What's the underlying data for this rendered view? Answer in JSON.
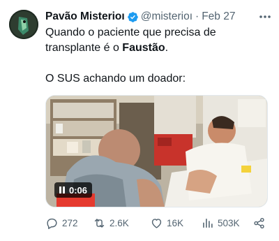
{
  "tweet": {
    "author_name": "Pavão Misterioı",
    "handle": "@misterioı",
    "separator": "·",
    "date": "Feb 27",
    "text_line1": "Quando o paciente que precisa de transplante é o ",
    "text_bold": "Faustão",
    "text_line1_end": ".",
    "text_line2": "O SUS achando um doador:",
    "media": {
      "time": "0:06"
    }
  },
  "actions": {
    "replies": "272",
    "reposts": "2.6K",
    "likes": "16K",
    "views": "503K"
  },
  "icons": {
    "verified": "verified-badge-icon",
    "more": "more-dots-icon",
    "reply": "reply-icon",
    "repost": "repost-icon",
    "like": "heart-icon",
    "views": "views-icon",
    "share": "share-icon"
  },
  "colors": {
    "verified": "#1d9bf0",
    "secondary_text": "#536471",
    "primary_text": "#0f1419"
  }
}
